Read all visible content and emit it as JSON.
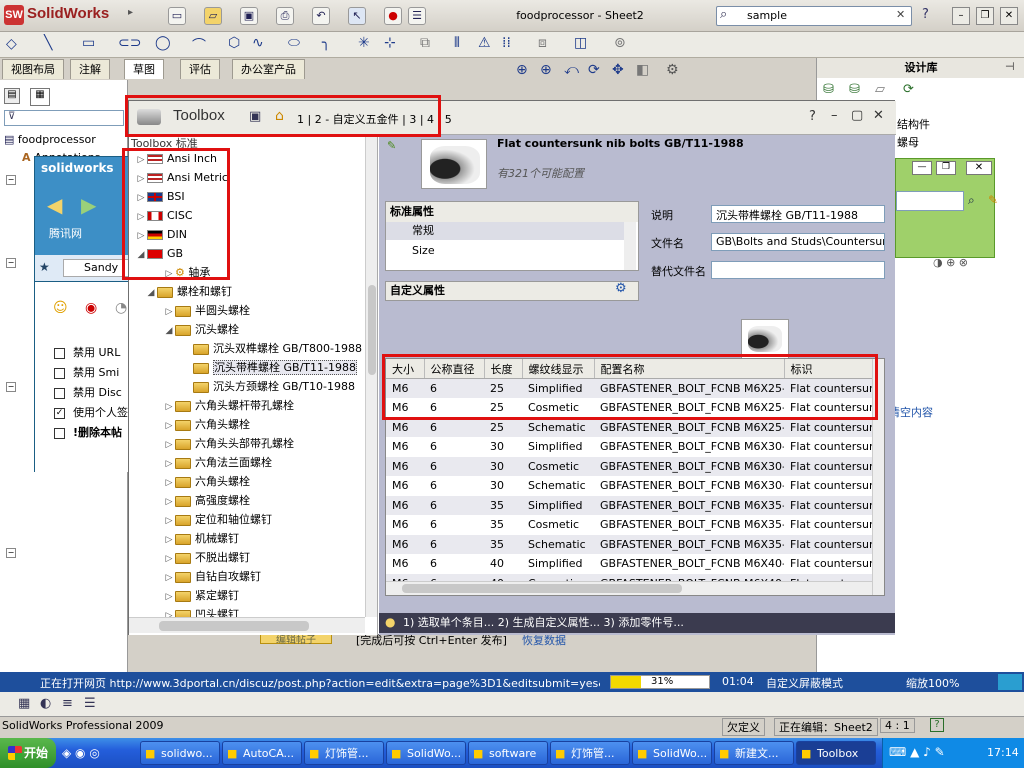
{
  "app": {
    "logo": "SolidWorks",
    "window_title": "foodprocessor - Sheet2",
    "search_value": "sample"
  },
  "tabs": [
    "视图布局",
    "注解",
    "草图",
    "评估",
    "办公室产品"
  ],
  "left_tree": {
    "root": "foodprocessor",
    "annotations": "Annotations"
  },
  "design_library": {
    "title": "设计库",
    "items": [
      "结构件",
      "螺母"
    ]
  },
  "popup": {
    "title": "solidworks",
    "nav": "腾讯网",
    "user": "Sandy",
    "checkboxes": [
      {
        "label": "禁用 URL",
        "checked": false
      },
      {
        "label": "禁用 Smi",
        "checked": false
      },
      {
        "label": "禁用 Disc",
        "checked": false
      },
      {
        "label": "使用个人签",
        "checked": true
      },
      {
        "label": "!删除本帖",
        "checked": false
      }
    ],
    "clear_link": "清空内容"
  },
  "toolbox": {
    "title": "Toolbox",
    "breadcrumb": "1 | 2 - 自定义五金件 | 3 | 4 | 5",
    "tree_header": "Toolbox 标准",
    "standards": [
      {
        "name": "Ansi Inch",
        "flag": "us"
      },
      {
        "name": "Ansi Metric",
        "flag": "us"
      },
      {
        "name": "BSI",
        "flag": "uk"
      },
      {
        "name": "CISC",
        "flag": "ca"
      },
      {
        "name": "DIN",
        "flag": "de"
      },
      {
        "name": "GB",
        "flag": "cn"
      }
    ],
    "tree_items": [
      {
        "label": "轴承",
        "depth": 2,
        "arrow": "▷",
        "type": "gear"
      },
      {
        "label": "螺栓和螺钉",
        "depth": 1,
        "arrow": "◢",
        "type": "folder"
      },
      {
        "label": "半圆头螺栓",
        "depth": 2,
        "arrow": "▷",
        "type": "folder"
      },
      {
        "label": "沉头螺栓",
        "depth": 2,
        "arrow": "◢",
        "type": "folder"
      },
      {
        "label": "沉头双榫螺栓 GB/T800-1988",
        "depth": 3,
        "arrow": "",
        "type": "folder"
      },
      {
        "label": "沉头带榫螺栓 GB/T11-1988",
        "depth": 3,
        "arrow": "",
        "type": "folder",
        "selected": true
      },
      {
        "label": "沉头方颈螺栓 GB/T10-1988",
        "depth": 3,
        "arrow": "",
        "type": "folder"
      },
      {
        "label": "六角头螺杆带孔螺栓",
        "depth": 2,
        "arrow": "▷",
        "type": "folder"
      },
      {
        "label": "六角头螺栓",
        "depth": 2,
        "arrow": "▷",
        "type": "folder"
      },
      {
        "label": "六角头头部带孔螺栓",
        "depth": 2,
        "arrow": "▷",
        "type": "folder"
      },
      {
        "label": "六角法兰面螺栓",
        "depth": 2,
        "arrow": "▷",
        "type": "folder"
      },
      {
        "label": "六角头螺栓",
        "depth": 2,
        "arrow": "▷",
        "type": "folder"
      },
      {
        "label": "高强度螺栓",
        "depth": 2,
        "arrow": "▷",
        "type": "folder"
      },
      {
        "label": "定位和轴位螺钉",
        "depth": 2,
        "arrow": "▷",
        "type": "folder"
      },
      {
        "label": "机械螺钉",
        "depth": 2,
        "arrow": "▷",
        "type": "folder"
      },
      {
        "label": "不脱出螺钉",
        "depth": 2,
        "arrow": "▷",
        "type": "folder"
      },
      {
        "label": "自钻自攻螺钉",
        "depth": 2,
        "arrow": "▷",
        "type": "folder"
      },
      {
        "label": "紧定螺钉",
        "depth": 2,
        "arrow": "▷",
        "type": "folder"
      },
      {
        "label": "凹头螺钉",
        "depth": 2,
        "arrow": "▷",
        "type": "folder"
      }
    ],
    "part_title": "Flat countersunk nib bolts GB/T11-1988",
    "config_count": "有321个可能配置",
    "std_props_header": "标准属性",
    "std_props": [
      "常规",
      "Size"
    ],
    "custom_props_header": "自定义属性",
    "fields": {
      "desc_label": "说明",
      "desc_value": "沉头带榫螺栓 GB/T11-1988",
      "file_label": "文件名",
      "file_value": "GB\\Bolts and Studs\\Countersunk h",
      "alt_label": "替代文件名",
      "alt_value": ""
    },
    "table": {
      "columns": [
        "大小",
        "公称直径",
        "长度",
        "螺纹线显示",
        "配置名称",
        "标识"
      ],
      "rows": [
        [
          "M6",
          "6",
          "25",
          "Simplified",
          "GBFASTENER_BOLT_FCNB M6X25-N",
          "Flat countersunk"
        ],
        [
          "M6",
          "6",
          "25",
          "Cosmetic",
          "GBFASTENER_BOLT_FCNB M6X25-C",
          "Flat countersunk"
        ],
        [
          "M6",
          "6",
          "25",
          "Schematic",
          "GBFASTENER_BOLT_FCNB M6X25-S",
          "Flat countersunk"
        ],
        [
          "M6",
          "6",
          "30",
          "Simplified",
          "GBFASTENER_BOLT_FCNB M6X30-N",
          "Flat countersunk"
        ],
        [
          "M6",
          "6",
          "30",
          "Cosmetic",
          "GBFASTENER_BOLT_FCNB M6X30-C",
          "Flat countersunk"
        ],
        [
          "M6",
          "6",
          "30",
          "Schematic",
          "GBFASTENER_BOLT_FCNB M6X30-S",
          "Flat countersunk"
        ],
        [
          "M6",
          "6",
          "35",
          "Simplified",
          "GBFASTENER_BOLT_FCNB M6X35-N",
          "Flat countersunk"
        ],
        [
          "M6",
          "6",
          "35",
          "Cosmetic",
          "GBFASTENER_BOLT_FCNB M6X35-C",
          "Flat countersunk"
        ],
        [
          "M6",
          "6",
          "35",
          "Schematic",
          "GBFASTENER_BOLT_FCNB M6X35-S",
          "Flat countersunk"
        ],
        [
          "M6",
          "6",
          "40",
          "Simplified",
          "GBFASTENER_BOLT_FCNB M6X40-N",
          "Flat countersunk"
        ],
        [
          "M6",
          "6",
          "40",
          "Cosmetic",
          "GBFASTENER_BOLT_FCNB M6X40-C",
          "Flat countersunk"
        ]
      ]
    },
    "hint": "1) 选取单个条目... 2) 生成自定义属性... 3) 添加零件号..."
  },
  "behind_text": {
    "edit_hint": "[完成后可按 Ctrl+Enter 发布]",
    "restore": "恢复数据",
    "btn": "编辑帖子"
  },
  "browser_status": {
    "text": "正在打开网页 http://www.3dportal.cn/discuz/post.php?action=edit&extra=page%3D1&editsubmit=yes&mod=...",
    "progress": 31,
    "progress_label": "31%",
    "time": "01:04",
    "mode": "自定义屏蔽模式",
    "zoom": "缩放100%"
  },
  "sw_status": {
    "product": "SolidWorks Professional 2009",
    "undefined": "欠定义",
    "editing": "正在编辑：Sheet2",
    "scale": "4 : 1"
  },
  "taskbar": {
    "start": "开始",
    "buttons": [
      "solidwo...",
      "AutoCA...",
      "灯饰管...",
      "SolidWo...",
      "software",
      "灯饰管...",
      "SolidWo...",
      "新建文...",
      "Toolbox"
    ],
    "active_index": 8,
    "clock": "17:14"
  }
}
